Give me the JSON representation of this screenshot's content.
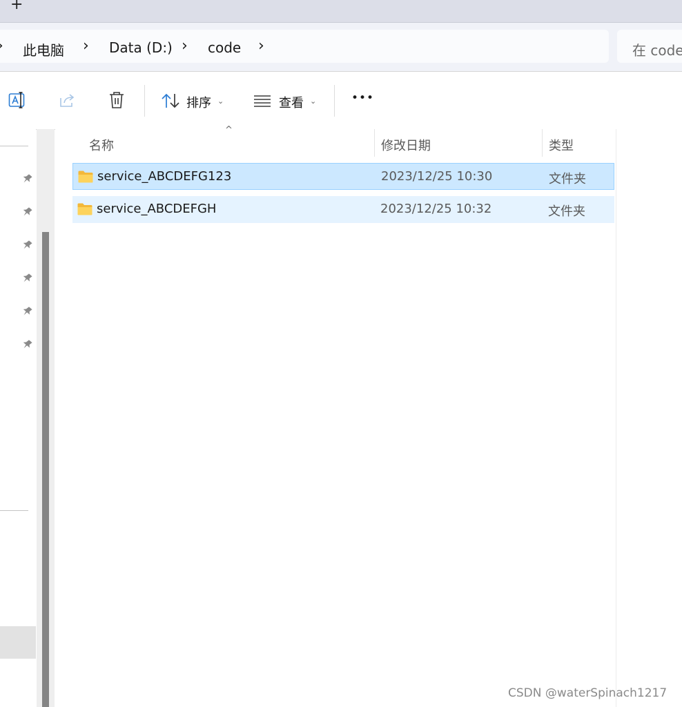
{
  "tabstrip": {
    "new_tab_label": "+"
  },
  "breadcrumb": {
    "items": [
      "此电脑",
      "Data (D:)",
      "code"
    ],
    "separator": "›"
  },
  "search": {
    "placeholder": "在 code"
  },
  "toolbar": {
    "sort_label": "排序",
    "view_label": "查看",
    "more_label": "•••",
    "dropdown_caret": "⌄"
  },
  "columns": {
    "name": "名称",
    "modified": "修改日期",
    "type": "类型",
    "sort_indicator": "^"
  },
  "files": [
    {
      "name": "service_ABCDEFG123",
      "modified": "2023/12/25 10:30",
      "type": "文件夹",
      "state": "selected"
    },
    {
      "name": "service_ABCDEFGH",
      "modified": "2023/12/25 10:32",
      "type": "文件夹",
      "state": "hover"
    }
  ],
  "colors": {
    "selected_row": "#cce8ff",
    "hover_row": "#e5f3ff",
    "accent_icon": "#2b7cd3",
    "folder_yellow": "#f7c948"
  },
  "icons": [
    "rename-icon",
    "share-icon",
    "delete-icon",
    "sort-icon",
    "view-list-icon",
    "more-icon",
    "pin-icon",
    "folder-icon"
  ],
  "watermark": "CSDN @waterSpinach1217"
}
